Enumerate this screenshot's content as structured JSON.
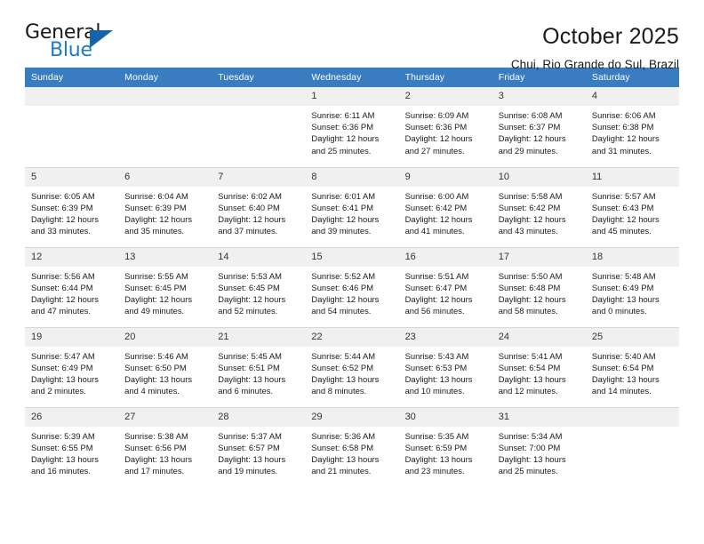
{
  "brand": {
    "name_primary": "General",
    "name_secondary": "Blue",
    "triangle_color": "#1464aa",
    "blue_color": "#1e7bc4"
  },
  "header": {
    "title": "October 2025",
    "subtitle": "Chui, Rio Grande do Sul, Brazil",
    "header_bg": "#3a7cc0",
    "daynum_bg": "#f0f0f0"
  },
  "weekdays": [
    "Sunday",
    "Monday",
    "Tuesday",
    "Wednesday",
    "Thursday",
    "Friday",
    "Saturday"
  ],
  "labels": {
    "sunrise_prefix": "Sunrise:",
    "sunset_prefix": "Sunset:",
    "daylight_prefix": "Daylight:"
  },
  "weeks": [
    [
      {
        "day": "",
        "empty": true
      },
      {
        "day": "",
        "empty": true
      },
      {
        "day": "",
        "empty": true
      },
      {
        "day": "1",
        "sunrise": "Sunrise: 6:11 AM",
        "sunset": "Sunset: 6:36 PM",
        "daylight1": "Daylight: 12 hours",
        "daylight2": "and 25 minutes."
      },
      {
        "day": "2",
        "sunrise": "Sunrise: 6:09 AM",
        "sunset": "Sunset: 6:36 PM",
        "daylight1": "Daylight: 12 hours",
        "daylight2": "and 27 minutes."
      },
      {
        "day": "3",
        "sunrise": "Sunrise: 6:08 AM",
        "sunset": "Sunset: 6:37 PM",
        "daylight1": "Daylight: 12 hours",
        "daylight2": "and 29 minutes."
      },
      {
        "day": "4",
        "sunrise": "Sunrise: 6:06 AM",
        "sunset": "Sunset: 6:38 PM",
        "daylight1": "Daylight: 12 hours",
        "daylight2": "and 31 minutes."
      }
    ],
    [
      {
        "day": "5",
        "sunrise": "Sunrise: 6:05 AM",
        "sunset": "Sunset: 6:39 PM",
        "daylight1": "Daylight: 12 hours",
        "daylight2": "and 33 minutes."
      },
      {
        "day": "6",
        "sunrise": "Sunrise: 6:04 AM",
        "sunset": "Sunset: 6:39 PM",
        "daylight1": "Daylight: 12 hours",
        "daylight2": "and 35 minutes."
      },
      {
        "day": "7",
        "sunrise": "Sunrise: 6:02 AM",
        "sunset": "Sunset: 6:40 PM",
        "daylight1": "Daylight: 12 hours",
        "daylight2": "and 37 minutes."
      },
      {
        "day": "8",
        "sunrise": "Sunrise: 6:01 AM",
        "sunset": "Sunset: 6:41 PM",
        "daylight1": "Daylight: 12 hours",
        "daylight2": "and 39 minutes."
      },
      {
        "day": "9",
        "sunrise": "Sunrise: 6:00 AM",
        "sunset": "Sunset: 6:42 PM",
        "daylight1": "Daylight: 12 hours",
        "daylight2": "and 41 minutes."
      },
      {
        "day": "10",
        "sunrise": "Sunrise: 5:58 AM",
        "sunset": "Sunset: 6:42 PM",
        "daylight1": "Daylight: 12 hours",
        "daylight2": "and 43 minutes."
      },
      {
        "day": "11",
        "sunrise": "Sunrise: 5:57 AM",
        "sunset": "Sunset: 6:43 PM",
        "daylight1": "Daylight: 12 hours",
        "daylight2": "and 45 minutes."
      }
    ],
    [
      {
        "day": "12",
        "sunrise": "Sunrise: 5:56 AM",
        "sunset": "Sunset: 6:44 PM",
        "daylight1": "Daylight: 12 hours",
        "daylight2": "and 47 minutes."
      },
      {
        "day": "13",
        "sunrise": "Sunrise: 5:55 AM",
        "sunset": "Sunset: 6:45 PM",
        "daylight1": "Daylight: 12 hours",
        "daylight2": "and 49 minutes."
      },
      {
        "day": "14",
        "sunrise": "Sunrise: 5:53 AM",
        "sunset": "Sunset: 6:45 PM",
        "daylight1": "Daylight: 12 hours",
        "daylight2": "and 52 minutes."
      },
      {
        "day": "15",
        "sunrise": "Sunrise: 5:52 AM",
        "sunset": "Sunset: 6:46 PM",
        "daylight1": "Daylight: 12 hours",
        "daylight2": "and 54 minutes."
      },
      {
        "day": "16",
        "sunrise": "Sunrise: 5:51 AM",
        "sunset": "Sunset: 6:47 PM",
        "daylight1": "Daylight: 12 hours",
        "daylight2": "and 56 minutes."
      },
      {
        "day": "17",
        "sunrise": "Sunrise: 5:50 AM",
        "sunset": "Sunset: 6:48 PM",
        "daylight1": "Daylight: 12 hours",
        "daylight2": "and 58 minutes."
      },
      {
        "day": "18",
        "sunrise": "Sunrise: 5:48 AM",
        "sunset": "Sunset: 6:49 PM",
        "daylight1": "Daylight: 13 hours",
        "daylight2": "and 0 minutes."
      }
    ],
    [
      {
        "day": "19",
        "sunrise": "Sunrise: 5:47 AM",
        "sunset": "Sunset: 6:49 PM",
        "daylight1": "Daylight: 13 hours",
        "daylight2": "and 2 minutes."
      },
      {
        "day": "20",
        "sunrise": "Sunrise: 5:46 AM",
        "sunset": "Sunset: 6:50 PM",
        "daylight1": "Daylight: 13 hours",
        "daylight2": "and 4 minutes."
      },
      {
        "day": "21",
        "sunrise": "Sunrise: 5:45 AM",
        "sunset": "Sunset: 6:51 PM",
        "daylight1": "Daylight: 13 hours",
        "daylight2": "and 6 minutes."
      },
      {
        "day": "22",
        "sunrise": "Sunrise: 5:44 AM",
        "sunset": "Sunset: 6:52 PM",
        "daylight1": "Daylight: 13 hours",
        "daylight2": "and 8 minutes."
      },
      {
        "day": "23",
        "sunrise": "Sunrise: 5:43 AM",
        "sunset": "Sunset: 6:53 PM",
        "daylight1": "Daylight: 13 hours",
        "daylight2": "and 10 minutes."
      },
      {
        "day": "24",
        "sunrise": "Sunrise: 5:41 AM",
        "sunset": "Sunset: 6:54 PM",
        "daylight1": "Daylight: 13 hours",
        "daylight2": "and 12 minutes."
      },
      {
        "day": "25",
        "sunrise": "Sunrise: 5:40 AM",
        "sunset": "Sunset: 6:54 PM",
        "daylight1": "Daylight: 13 hours",
        "daylight2": "and 14 minutes."
      }
    ],
    [
      {
        "day": "26",
        "sunrise": "Sunrise: 5:39 AM",
        "sunset": "Sunset: 6:55 PM",
        "daylight1": "Daylight: 13 hours",
        "daylight2": "and 16 minutes."
      },
      {
        "day": "27",
        "sunrise": "Sunrise: 5:38 AM",
        "sunset": "Sunset: 6:56 PM",
        "daylight1": "Daylight: 13 hours",
        "daylight2": "and 17 minutes."
      },
      {
        "day": "28",
        "sunrise": "Sunrise: 5:37 AM",
        "sunset": "Sunset: 6:57 PM",
        "daylight1": "Daylight: 13 hours",
        "daylight2": "and 19 minutes."
      },
      {
        "day": "29",
        "sunrise": "Sunrise: 5:36 AM",
        "sunset": "Sunset: 6:58 PM",
        "daylight1": "Daylight: 13 hours",
        "daylight2": "and 21 minutes."
      },
      {
        "day": "30",
        "sunrise": "Sunrise: 5:35 AM",
        "sunset": "Sunset: 6:59 PM",
        "daylight1": "Daylight: 13 hours",
        "daylight2": "and 23 minutes."
      },
      {
        "day": "31",
        "sunrise": "Sunrise: 5:34 AM",
        "sunset": "Sunset: 7:00 PM",
        "daylight1": "Daylight: 13 hours",
        "daylight2": "and 25 minutes."
      },
      {
        "day": "",
        "empty": true
      }
    ]
  ]
}
